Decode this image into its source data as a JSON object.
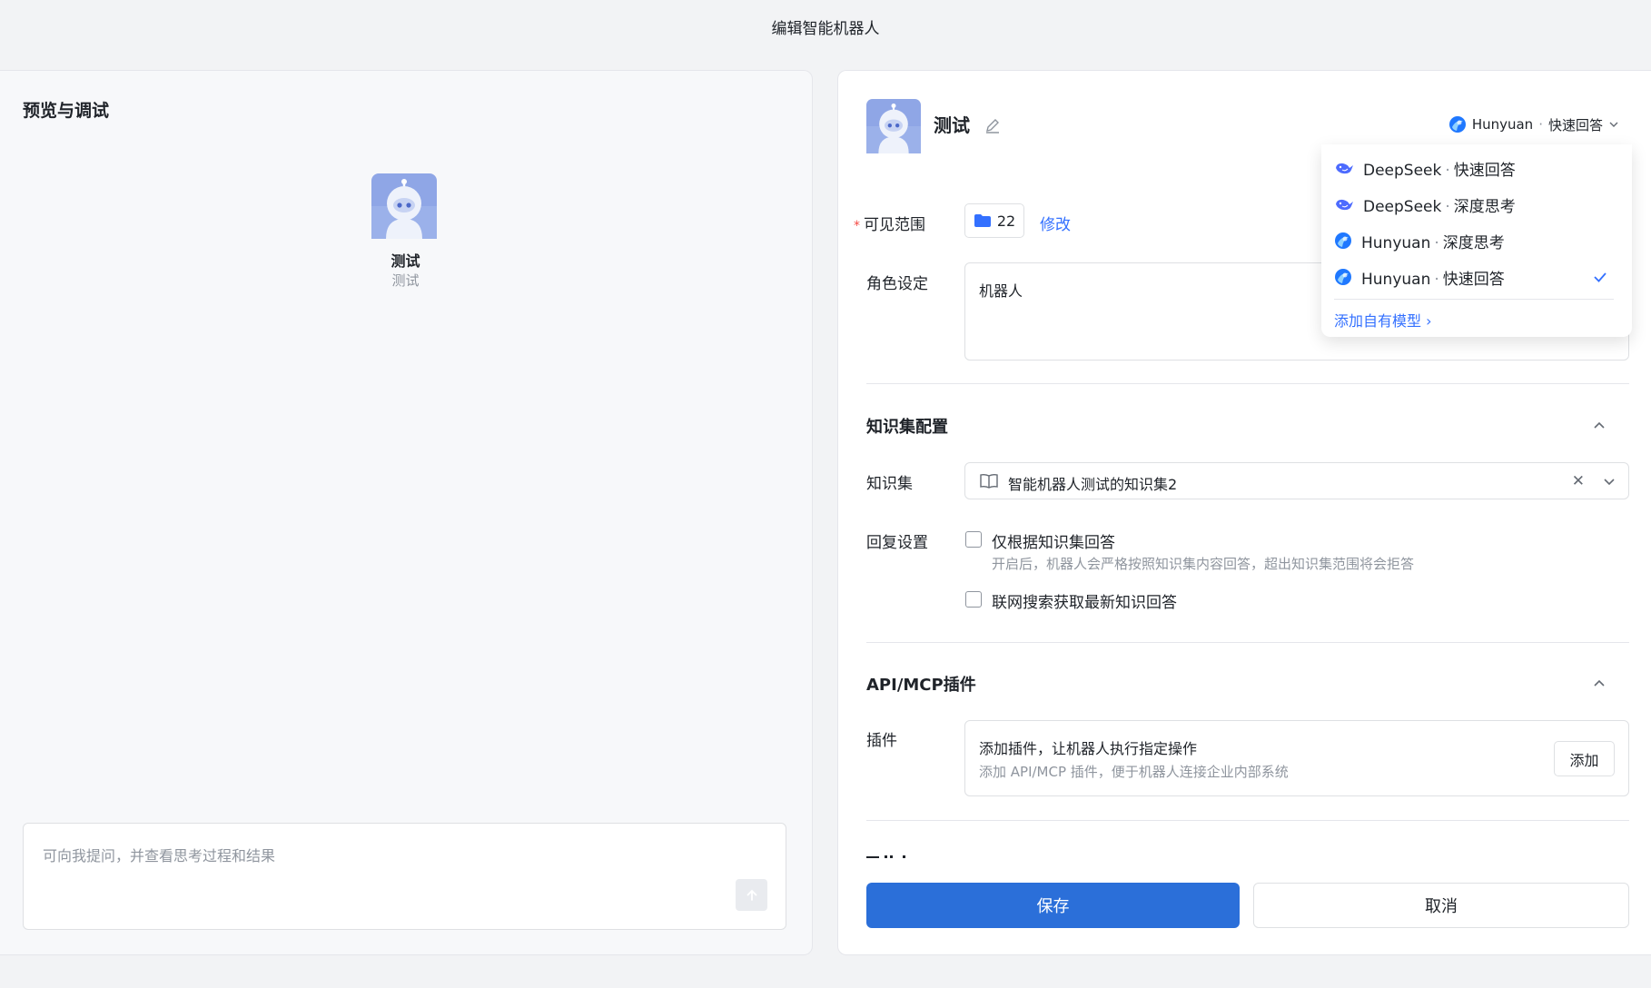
{
  "modal": {
    "title": "编辑智能机器人"
  },
  "preview": {
    "title": "预览与调试",
    "bot_name": "测试",
    "bot_desc": "测试",
    "chat_placeholder": "可向我提问，并查看思考过程和结果"
  },
  "editor": {
    "bot_name": "测试",
    "model_selected": {
      "provider": "Hunyuan",
      "mode": "快速回答",
      "separator": "·"
    },
    "scope": {
      "label": "可见范围",
      "required_mark": "*",
      "count": "22",
      "edit_link": "修改"
    },
    "role": {
      "label": "角色设定",
      "value": "机器人"
    },
    "knowledge": {
      "section_title": "知识集配置",
      "kb_label": "知识集",
      "kb_value": "智能机器人测试的知识集2",
      "reply_label": "回复设置",
      "only_kb_label": "仅根据知识集回答",
      "only_kb_desc": "开启后，机器人会严格按照知识集内容回答，超出知识集范围将会拒答",
      "web_search_label": "联网搜索获取最新知识回答"
    },
    "plugins": {
      "section_title": "API/MCP插件",
      "label": "插件",
      "box_title": "添加插件，让机器人执行指定操作",
      "box_desc": "添加 API/MCP 插件，便于机器人连接企业内部系统",
      "add_button": "添加"
    },
    "save_button": "保存",
    "cancel_button": "取消"
  },
  "model_dropdown": {
    "options": [
      {
        "provider": "DeepSeek",
        "mode": "快速回答",
        "icon": "deepseek-icon",
        "selected": false
      },
      {
        "provider": "DeepSeek",
        "mode": "深度思考",
        "icon": "deepseek-icon",
        "selected": false
      },
      {
        "provider": "Hunyuan",
        "mode": "深度思考",
        "icon": "hunyuan-icon",
        "selected": false
      },
      {
        "provider": "Hunyuan",
        "mode": "快速回答",
        "icon": "hunyuan-icon",
        "selected": true
      }
    ],
    "add_own_model": "添加自有模型 ›"
  },
  "colors": {
    "primary": "#2b6fd9",
    "link": "#3370ff",
    "required": "#f54a45",
    "avatar_bg": "#8fa6e6"
  }
}
